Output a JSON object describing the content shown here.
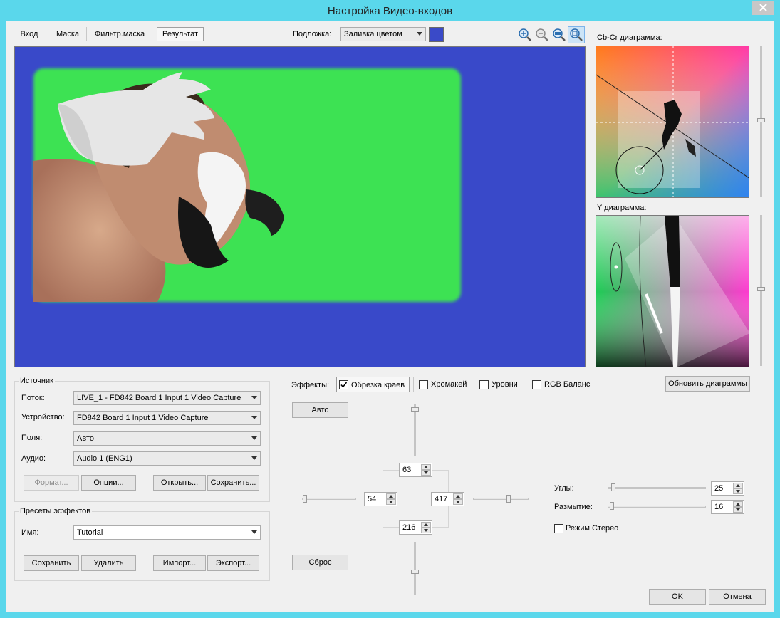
{
  "window": {
    "title": "Настройка Видео-входов"
  },
  "tabs": [
    {
      "label": "Вход"
    },
    {
      "label": "Маска"
    },
    {
      "label": "Фильтр.маска"
    },
    {
      "label": "Результат",
      "active": true
    }
  ],
  "background": {
    "label": "Подложка:",
    "value": "Заливка цветом",
    "swatch_color": "#3a4ac8"
  },
  "zoom": {
    "in": "zoom-in-icon",
    "out": "zoom-out-icon",
    "fit": "zoom-100-icon",
    "actual": "zoom-fit-icon"
  },
  "diagrams": {
    "cbcr_title": "Cb-Cr диаграмма:",
    "y_title": "Y диаграмма:"
  },
  "preview": {
    "bg_color": "#3949c9",
    "key_color": "#3ee253"
  },
  "source": {
    "title": "Источник",
    "stream_label": "Поток:",
    "stream_value": "LIVE_1 - FD842 Board 1 Input 1 Video Capture",
    "device_label": "Устройство:",
    "device_value": "FD842 Board 1 Input 1 Video Capture",
    "fields_label": "Поля:",
    "fields_value": "Авто",
    "audio_label": "Аудио:",
    "audio_value": "Audio 1 (ENG1)",
    "format_btn": "Формат...",
    "options_btn": "Опции...",
    "open_btn": "Открыть...",
    "save_btn": "Сохранить..."
  },
  "presets": {
    "title": "Пресеты эффектов",
    "name_label": "Имя:",
    "name_value": "Tutorial",
    "save_btn": "Сохранить",
    "delete_btn": "Удалить",
    "import_btn": "Импорт...",
    "export_btn": "Экспорт..."
  },
  "effects": {
    "label": "Эффекты:",
    "crop": {
      "label": "Обрезка краев",
      "checked": true
    },
    "chroma": {
      "label": "Хромакей",
      "checked": false
    },
    "levels": {
      "label": "Уровни",
      "checked": false
    },
    "rgb": {
      "label": "RGB Баланс",
      "checked": false
    },
    "refresh_btn": "Обновить диаграммы"
  },
  "crop": {
    "auto_btn": "Авто",
    "reset_btn": "Сброс",
    "top": "63",
    "left": "54",
    "right": "417",
    "bottom": "216",
    "corners_label": "Углы:",
    "corners_value": "25",
    "blur_label": "Размытие:",
    "blur_value": "16",
    "stereo_label": "Режим Стерео"
  },
  "dialog": {
    "ok": "OK",
    "cancel": "Отмена"
  }
}
